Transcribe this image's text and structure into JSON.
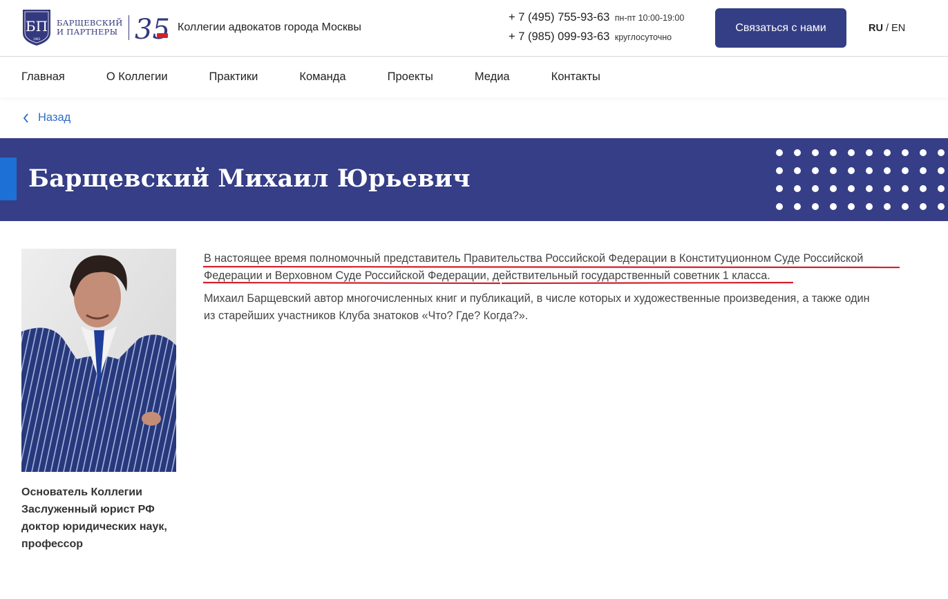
{
  "header": {
    "logo_line1": "БАРЩЕВСКИЙ",
    "logo_line2": "И ПАРТНЕРЫ",
    "logo_monogram": "БП",
    "logo_year": "1993",
    "logo_anniversary": "35",
    "tagline": "Коллегии адвокатов города Москвы",
    "phones": [
      {
        "number": "+ 7 (495) 755-93-63",
        "hours": "пн-пт 10:00-19:00"
      },
      {
        "number": "+ 7 (985) 099-93-63",
        "hours": "круглосуточно"
      }
    ],
    "contact_button": "Связаться с нами",
    "lang_ru": "RU",
    "lang_sep": "/",
    "lang_en": "EN"
  },
  "nav": {
    "items": [
      "Главная",
      "О Коллегии",
      "Практики",
      "Команда",
      "Проекты",
      "Медиа",
      "Контакты"
    ]
  },
  "back_label": "Назад",
  "banner": {
    "title": "Барщевский Михаил Юрьевич"
  },
  "profile": {
    "caption": [
      "Основатель Коллегии",
      "Заслуженный юрист РФ",
      "доктор юридических наук,",
      "профессор"
    ],
    "paragraph1_lines": [
      "В настоящее время полномочный представитель Правительства Российской Федерации в Конституционном Суде Российской",
      "Федерации и Верховном Суде Российской Федерации, действительный государственный советник 1 класса."
    ],
    "paragraph2_lines": [
      "Михаил Барщевский автор многочисленных книг и публикаций, в числе которых и художественные произведения, а также один",
      "из старейших участников Клуба знатоков «Что? Где? Когда?»."
    ]
  },
  "colors": {
    "brand": "#353e86",
    "accent": "#1d70d6",
    "link": "#2f6cc5",
    "annotation": "#d3202b"
  }
}
